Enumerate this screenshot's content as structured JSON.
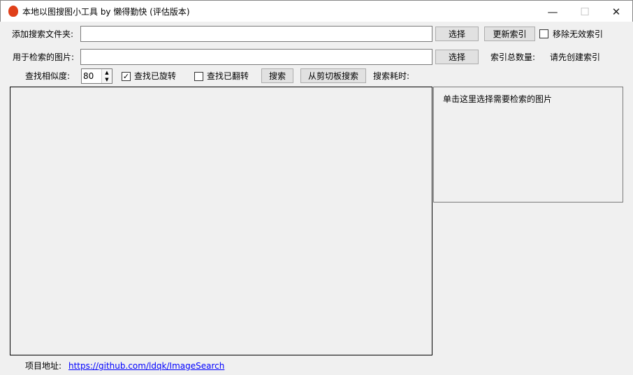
{
  "window": {
    "title": "本地以图搜图小工具 by 懒得勤快 (评估版本)",
    "minimize": "—",
    "maximize": "☐",
    "close": "✕"
  },
  "folder": {
    "label": "添加搜索文件夹:",
    "value": "",
    "select": "选择",
    "update_index": "更新索引",
    "remove_invalid": "移除无效索引",
    "remove_invalid_checked": false
  },
  "image": {
    "label": "用于检索的图片:",
    "value": "",
    "select": "选择",
    "index_count_label": "索引总数量:",
    "index_count_value": "请先创建索引"
  },
  "search": {
    "similarity_label": "查找相似度:",
    "similarity_value": "80",
    "rotated_label": "查找已旋转",
    "rotated_checked": "✓",
    "flipped_label": "查找已翻转",
    "search_button": "搜索",
    "clipboard_button": "从剪切板搜索",
    "time_label": "搜索耗时:"
  },
  "preview": {
    "hint": "单击这里选择需要检索的图片"
  },
  "footer": {
    "label": "项目地址:",
    "url": "https://github.com/ldqk/ImageSearch"
  }
}
